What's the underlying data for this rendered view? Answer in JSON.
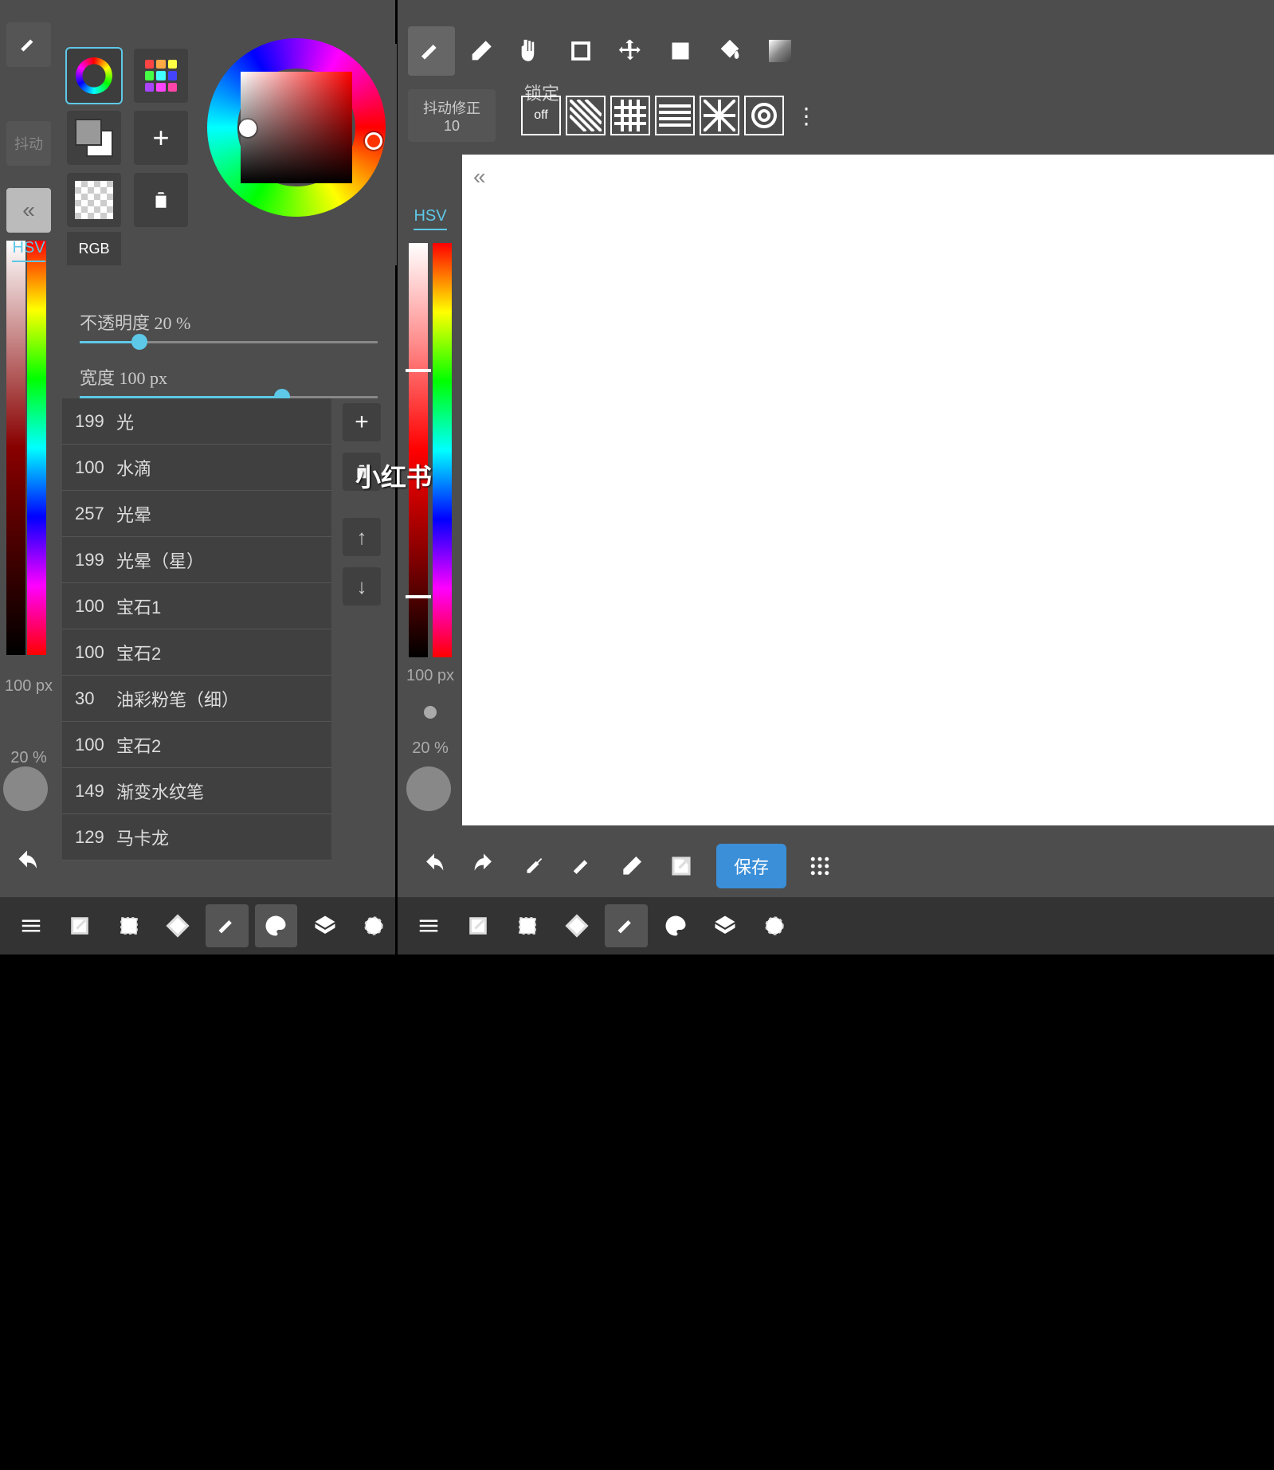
{
  "top_tools": {
    "jitter_label": "抖动修正",
    "jitter_value": "10",
    "lock_label": "锁定",
    "lock_off": "off"
  },
  "color_panel": {
    "rgb": "RGB"
  },
  "sliders": {
    "opacity_label": "不透明度  20 %",
    "opacity_pct": 20,
    "width_label": "宽度  100 px",
    "width_pct": 68
  },
  "brushes": [
    {
      "size": "199",
      "name": "光"
    },
    {
      "size": "100",
      "name": "水滴"
    },
    {
      "size": "257",
      "name": "光晕"
    },
    {
      "size": "199",
      "name": "光晕（星）"
    },
    {
      "size": "100",
      "name": "宝石1"
    },
    {
      "size": "100",
      "name": "宝石2"
    },
    {
      "size": "30",
      "name": "油彩粉笔（细）"
    },
    {
      "size": "100",
      "name": "宝石2"
    },
    {
      "size": "149",
      "name": "渐变水纹笔"
    },
    {
      "size": "129",
      "name": "马卡龙"
    }
  ],
  "hsv": {
    "label": "HSV",
    "px": "100 px",
    "pct": "20 %"
  },
  "save": "保存",
  "watermark": "小红书",
  "left_stats": {
    "px": "100 px",
    "pct": "20 %"
  }
}
